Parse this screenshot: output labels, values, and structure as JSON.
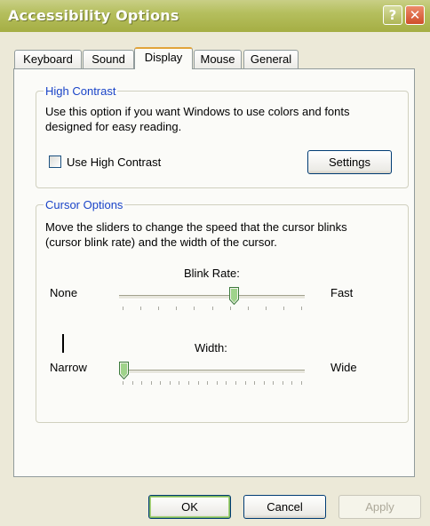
{
  "window": {
    "title": "Accessibility Options",
    "help_label": "?",
    "close_label": "✕"
  },
  "tabs": [
    {
      "label": "Keyboard",
      "active": false
    },
    {
      "label": "Sound",
      "active": false
    },
    {
      "label": "Display",
      "active": true
    },
    {
      "label": "Mouse",
      "active": false
    },
    {
      "label": "General",
      "active": false
    }
  ],
  "high_contrast": {
    "legend": "High Contrast",
    "description_line1": "Use this option if you want Windows to use colors and fonts",
    "description_line2": "designed for easy reading.",
    "checkbox_label": "Use High Contrast",
    "checked": false,
    "settings_label": "Settings"
  },
  "cursor_options": {
    "legend": "Cursor Options",
    "description_line1": "Move the sliders to change the speed that the cursor blinks",
    "description_line2": "(cursor blink rate) and the width of the cursor.",
    "blink_rate": {
      "label": "Blink Rate:",
      "min_label": "None",
      "max_label": "Fast",
      "value_fraction": 0.625
    },
    "width": {
      "label": "Width:",
      "min_label": "Narrow",
      "max_label": "Wide",
      "value_fraction": 0.0
    }
  },
  "buttons": {
    "ok": "OK",
    "cancel": "Cancel",
    "apply": "Apply"
  },
  "colors": {
    "titlebar": "#b5bf5e",
    "legend_text": "#1a44c8",
    "dialog_bg": "#ECE9D8"
  },
  "icons": {
    "help": "help-icon",
    "close": "close-icon",
    "slider_thumb": "slider-thumb-icon"
  }
}
